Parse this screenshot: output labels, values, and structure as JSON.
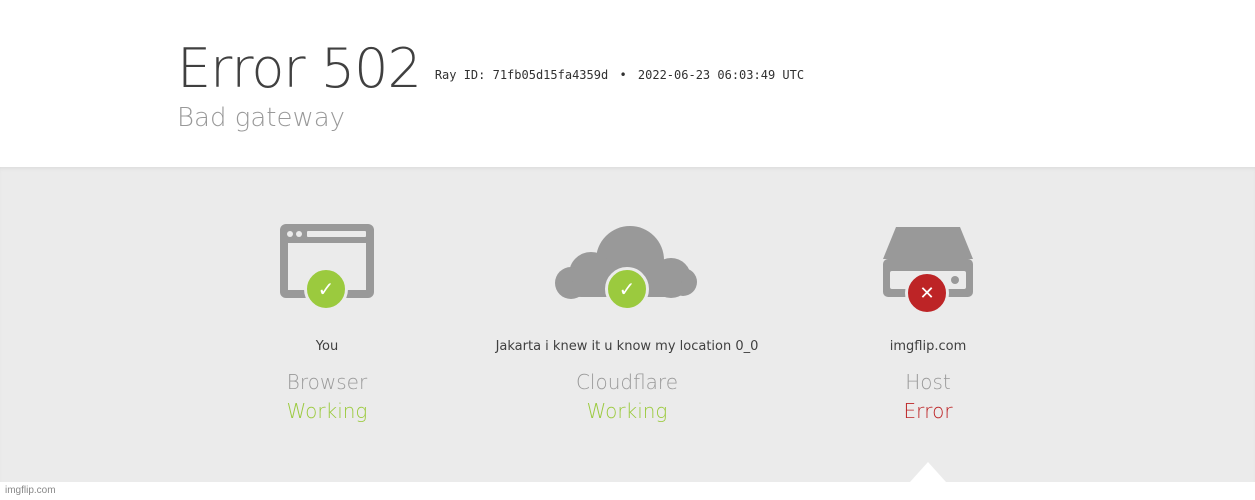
{
  "header": {
    "title": "Error 502",
    "ray_id": "Ray ID: 71fb05d15fa4359d",
    "separator": "•",
    "timestamp": "2022-06-23 06:03:49 UTC",
    "subtitle": "Bad gateway"
  },
  "nodes": [
    {
      "location": "You",
      "role": "Browser",
      "status": "Working",
      "icon": "browser-icon",
      "state": "ok"
    },
    {
      "location": "Jakarta i knew it u know my location 0_0",
      "role": "Cloudflare",
      "status": "Working",
      "icon": "cloud-icon",
      "state": "ok"
    },
    {
      "location": "imgflip.com",
      "role": "Host",
      "status": "Error",
      "icon": "server-icon",
      "state": "error"
    }
  ],
  "colors": {
    "working": "#9bca3e",
    "error": "#bd2426",
    "icon_gray": "#999999",
    "band": "#ebebeb"
  },
  "watermark": "imgflip.com"
}
